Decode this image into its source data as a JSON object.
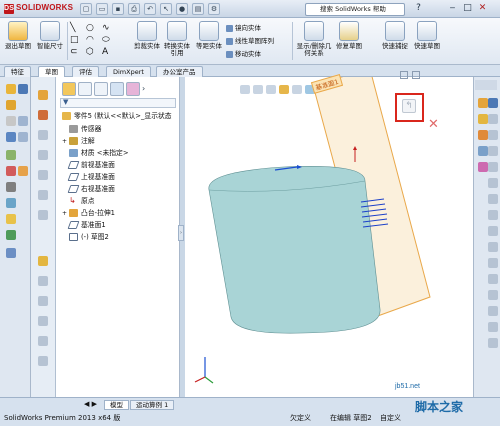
{
  "app": {
    "logo_text": "SOLIDWORKS",
    "logo_mark": "DS",
    "search_placeholder": "搜索 SolidWorks 帮助",
    "window_controls": [
      "‒",
      "□",
      "✕"
    ]
  },
  "ribbon": {
    "exit_sketch": "退出草图",
    "smart_dimension": "智能尺寸",
    "trim_entities": "剪裁实体",
    "convert_entities": "转换实体引用",
    "offset_entities": "等距实体",
    "mirror_entities": "镜向实体",
    "linear_pattern": "线性草图阵列",
    "move_entities": "移动实体",
    "display_delete_relations": "显示/删除几何关系",
    "repair_sketch": "修复草图",
    "quick_snaps": "快速捕捉",
    "rapid_sketch": "快速草图"
  },
  "tabs": [
    "特征",
    "草图",
    "评估",
    "DimXpert",
    "办公室产品"
  ],
  "active_tab": "草图",
  "feature_tree": {
    "root": "零件5 (默认<<默认>_显示状态",
    "items": [
      "传感器",
      "注解",
      "材质 <未指定>",
      "前视基准面",
      "上视基准面",
      "右视基准面",
      "原点",
      "凸台-拉伸1",
      "基准面1",
      "(-) 草图2"
    ]
  },
  "viewport": {
    "plane_label": "基准面1",
    "confirm_icon": "sketch-exit-confirm-icon",
    "cancel_icon": "close-icon",
    "highlight_color": "#d9261c",
    "cylinder_color": "#a9d4d6"
  },
  "model_tabs": [
    "模型",
    "运动算例 1"
  ],
  "status": {
    "app_version": "SolidWorks Premium 2013 x64 版",
    "state": "欠定义",
    "editing": "在编辑 草图2",
    "units": "自定义"
  },
  "watermark": {
    "site": "jb51.net",
    "name": "脚本之家"
  }
}
